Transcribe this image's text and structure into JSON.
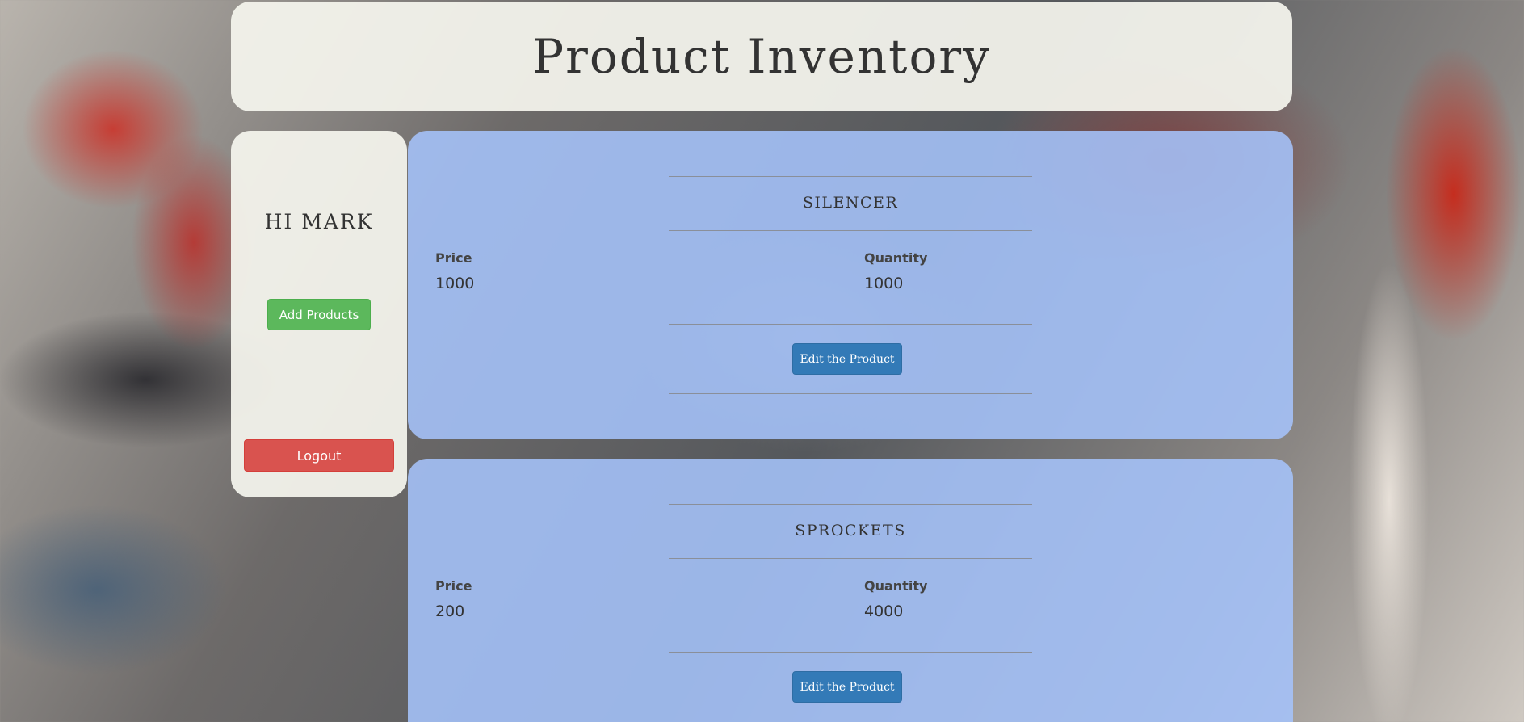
{
  "header": {
    "title": "Product Inventory"
  },
  "sidebar": {
    "greeting": "HI MARK",
    "add_products_label": "Add Products",
    "logout_label": "Logout"
  },
  "products": [
    {
      "name": "SILENCER",
      "price_label": "Price",
      "price": "1000",
      "quantity_label": "Quantity",
      "quantity": "1000",
      "edit_label": "Edit the Product"
    },
    {
      "name": "SPROCKETS",
      "price_label": "Price",
      "price": "200",
      "quantity_label": "Quantity",
      "quantity": "4000",
      "edit_label": "Edit the Product"
    }
  ],
  "colors": {
    "add_button": "#5cb85c",
    "logout_button": "#d9534f",
    "edit_button": "#337ab7",
    "product_card": "#a5c3fa"
  }
}
